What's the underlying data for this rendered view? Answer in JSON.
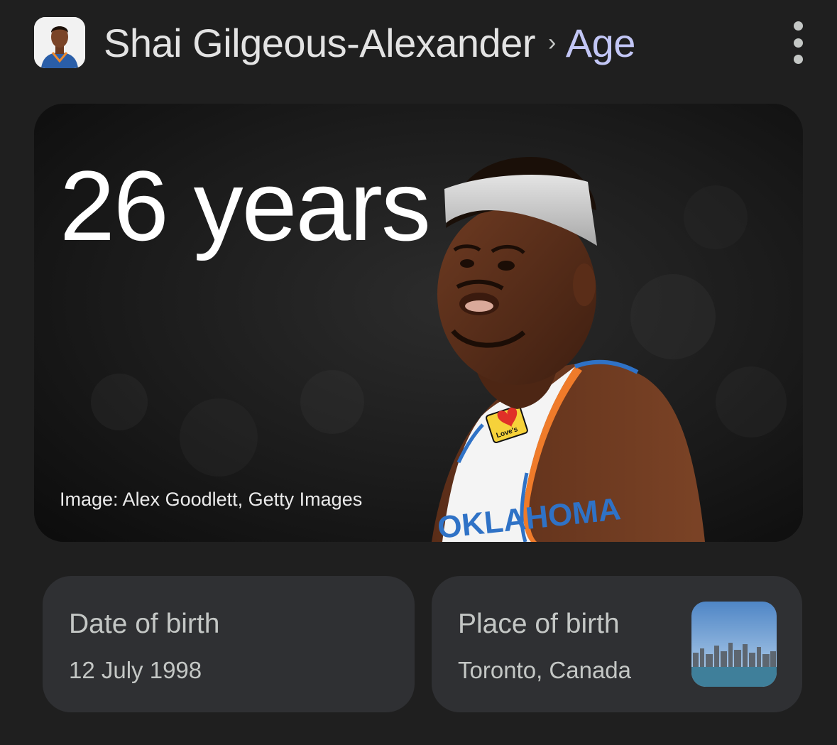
{
  "header": {
    "title": "Shai Gilgeous-Alexander",
    "separator": "›",
    "crumb": "Age",
    "avatar_icon": "player-headshot-icon",
    "menu_icon": "more-vert-icon"
  },
  "hero": {
    "age_text": "26 years",
    "image_credit": "Image: Alex Goodlett, Getty Images",
    "jersey_sponsor": "Love's",
    "jersey_text": "OKLAHOMA"
  },
  "facts": [
    {
      "label": "Date of birth",
      "value": "12 July 1998"
    },
    {
      "label": "Place of birth",
      "value": "Toronto, Canada",
      "thumbnail_icon": "toronto-skyline-icon"
    }
  ],
  "colors": {
    "background": "#1f1f1f",
    "card": "#2f3033",
    "crumb_accent": "#c2c6f5",
    "jersey_orange": "#ef7b2a",
    "jersey_blue": "#2f72c6"
  }
}
